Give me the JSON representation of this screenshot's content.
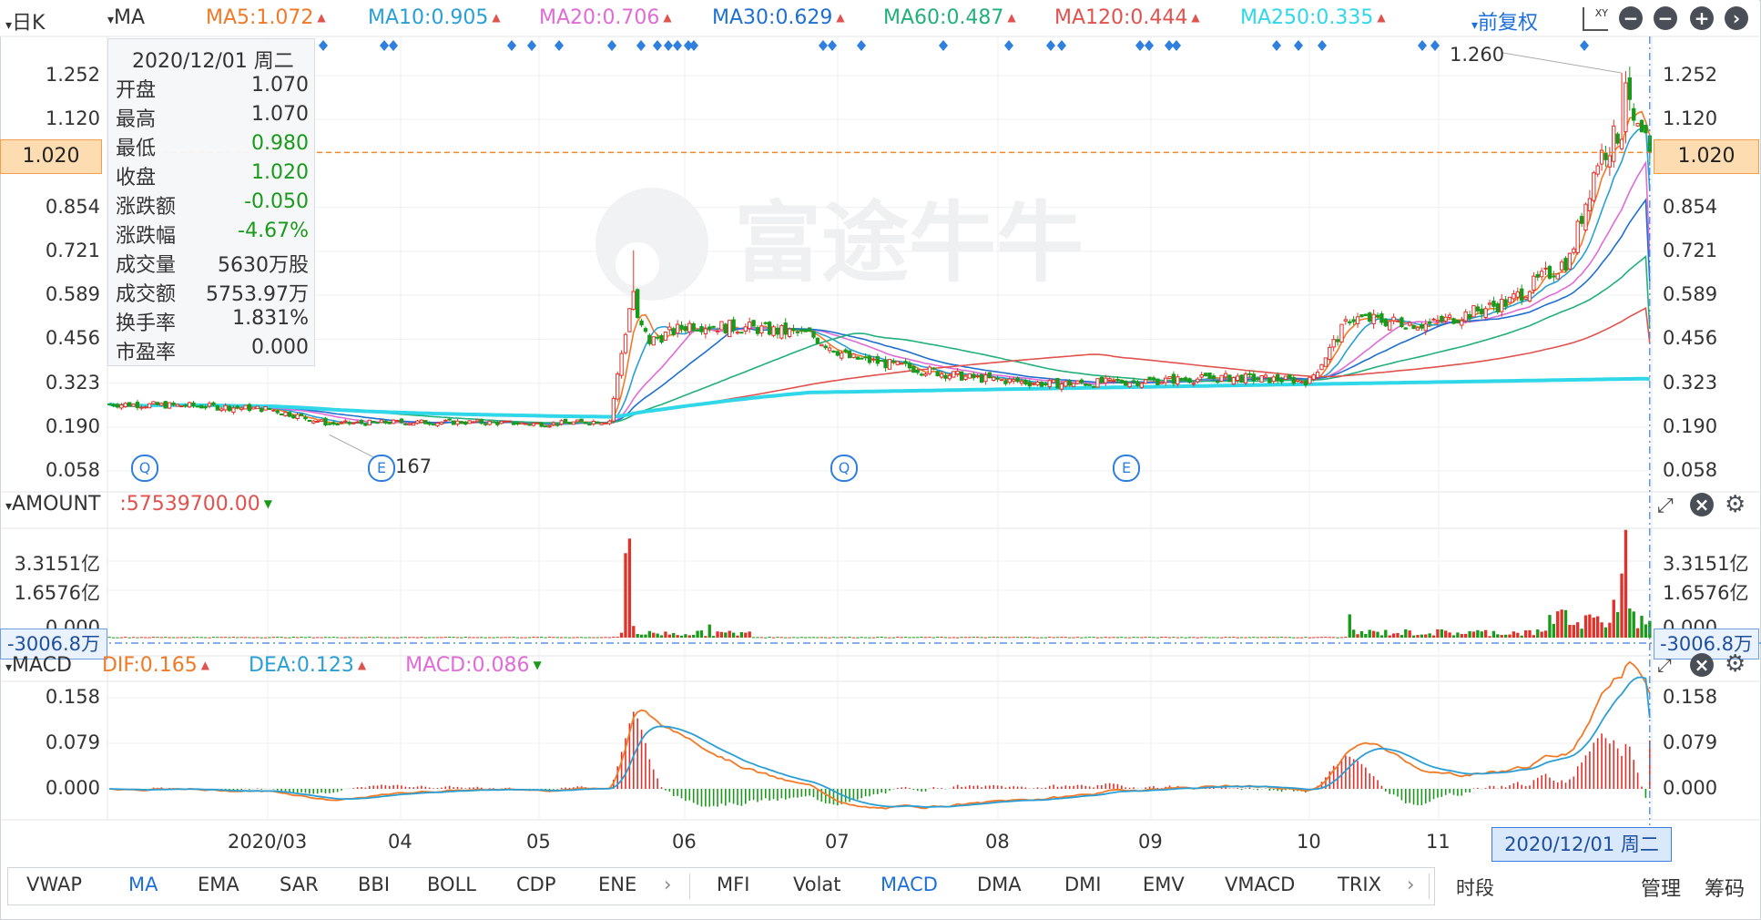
{
  "toolbar": {
    "period": "日K",
    "indicator": "MA",
    "ma": [
      {
        "label": "MA5:1.072",
        "color": "#f07a28"
      },
      {
        "label": "MA10:0.905",
        "color": "#2a9fd6"
      },
      {
        "label": "MA20:0.706",
        "color": "#e06bd6"
      },
      {
        "label": "MA30:0.629",
        "color": "#1f6fd0"
      },
      {
        "label": "MA60:0.487",
        "color": "#22b07a"
      },
      {
        "label": "MA120:0.444",
        "color": "#e0524e"
      },
      {
        "label": "MA250:0.335",
        "color": "#2fd7e8"
      }
    ],
    "adjust": "前复权",
    "xy_icon": "XY"
  },
  "info": {
    "date": "2020/12/01 周二",
    "rows": [
      {
        "k": "开盘",
        "v": "1.070",
        "c": "#333333"
      },
      {
        "k": "最高",
        "v": "1.070",
        "c": "#333333"
      },
      {
        "k": "最低",
        "v": "0.980",
        "c": "#1a9a1a"
      },
      {
        "k": "收盘",
        "v": "1.020",
        "c": "#1a9a1a"
      },
      {
        "k": "涨跌额",
        "v": "-0.050",
        "c": "#1a9a1a"
      },
      {
        "k": "涨跌幅",
        "v": "-4.67%",
        "c": "#1a9a1a"
      },
      {
        "k": "成交量",
        "v": "5630万股",
        "c": "#333333"
      },
      {
        "k": "成交额",
        "v": "5753.97万",
        "c": "#333333"
      },
      {
        "k": "换手率",
        "v": "1.831%",
        "c": "#333333"
      },
      {
        "k": "市盈率",
        "v": "0.000",
        "c": "#333333"
      }
    ]
  },
  "watermark": "富途牛牛",
  "price_axis": {
    "labels": [
      "1.252",
      "1.120",
      "1.020",
      "0.854",
      "0.721",
      "0.589",
      "0.456",
      "0.323",
      "0.190",
      "0.058"
    ],
    "current": "1.020",
    "high_label": "1.260",
    "low_label": "167"
  },
  "amount": {
    "title": "AMOUNT",
    "value": ":57539700.00",
    "axis": [
      "3.3151亿",
      "1.6576亿",
      "0.000"
    ],
    "crosshair": "-3006.8万"
  },
  "macd": {
    "title": "MACD",
    "dif": "DIF:0.165",
    "dea": "DEA:0.123",
    "macd": "MACD:0.086",
    "axis": [
      "0.158",
      "0.079",
      "0.000"
    ]
  },
  "x_axis": {
    "labels": [
      "2020/03",
      "04",
      "05",
      "06",
      "07",
      "08",
      "09",
      "10",
      "11"
    ],
    "crosshair": "2020/12/01 周二"
  },
  "tabs": {
    "left": [
      "VWAP",
      "MA",
      "EMA",
      "SAR",
      "BBI",
      "BOLL",
      "CDP",
      "ENE"
    ],
    "right": [
      "MFI",
      "Volat",
      "MACD",
      "DMA",
      "DMI",
      "EMV",
      "VMACD",
      "TRIX"
    ],
    "period": "时段",
    "actions": [
      "管理",
      "筹码"
    ]
  },
  "chart_data": [
    {
      "type": "candlestick",
      "title": "日K",
      "ylim": [
        0.058,
        1.252
      ],
      "ticks": [
        1.252,
        1.12,
        1.02,
        0.854,
        0.721,
        0.589,
        0.456,
        0.323,
        0.19,
        0.058
      ],
      "x_months": [
        "2020/03",
        "04",
        "05",
        "06",
        "07",
        "08",
        "09",
        "10",
        "11"
      ],
      "current_price": 1.02,
      "max_marker": 1.26,
      "series_close_anchor": [
        [
          0,
          0.26
        ],
        [
          20,
          0.255
        ],
        [
          40,
          0.245
        ],
        [
          55,
          0.2
        ],
        [
          70,
          0.205
        ],
        [
          90,
          0.205
        ],
        [
          110,
          0.2
        ],
        [
          125,
          0.21
        ],
        [
          130,
          0.55
        ],
        [
          135,
          0.45
        ],
        [
          145,
          0.5
        ],
        [
          160,
          0.49
        ],
        [
          175,
          0.47
        ],
        [
          185,
          0.4
        ],
        [
          200,
          0.37
        ],
        [
          215,
          0.34
        ],
        [
          235,
          0.32
        ],
        [
          260,
          0.33
        ],
        [
          280,
          0.34
        ],
        [
          300,
          0.33
        ],
        [
          310,
          0.52
        ],
        [
          330,
          0.5
        ],
        [
          350,
          0.57
        ],
        [
          365,
          0.7
        ],
        [
          372,
          1.0
        ],
        [
          380,
          1.12
        ],
        [
          385,
          1.02
        ]
      ],
      "ma_lines": [
        {
          "name": "MA5",
          "last": 1.072
        },
        {
          "name": "MA10",
          "last": 0.905
        },
        {
          "name": "MA20",
          "last": 0.706
        },
        {
          "name": "MA30",
          "last": 0.629
        },
        {
          "name": "MA60",
          "last": 0.487
        },
        {
          "name": "MA120",
          "last": 0.444
        },
        {
          "name": "MA250",
          "last": 0.335
        }
      ]
    },
    {
      "type": "bar",
      "title": "AMOUNT",
      "ylim": [
        0,
        3.3151
      ],
      "ticks": [
        3.3151,
        1.6576,
        0.0
      ],
      "units": "亿",
      "last": 57539700.0
    },
    {
      "type": "line",
      "title": "MACD",
      "ylim": [
        -0.03,
        0.17
      ],
      "ticks": [
        0.158,
        0.079,
        0.0
      ],
      "series": [
        {
          "name": "DIF",
          "last": 0.165
        },
        {
          "name": "DEA",
          "last": 0.123
        },
        {
          "name": "MACD",
          "last": 0.086
        }
      ]
    }
  ]
}
